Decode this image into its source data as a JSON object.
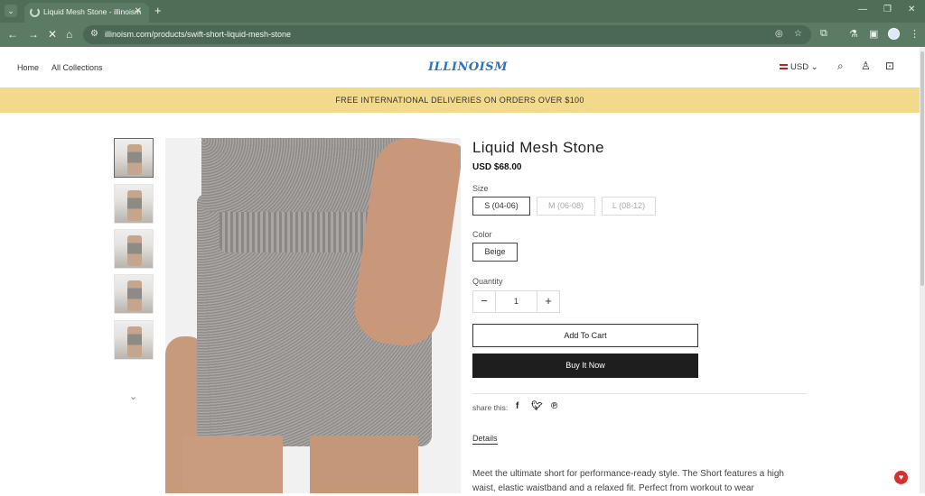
{
  "browser": {
    "tab_title": "Liquid Mesh Stone - illinoism",
    "url": "illinoism.com/products/swift-short-liquid-mesh-stone"
  },
  "header": {
    "nav": [
      "Home",
      "All Collections"
    ],
    "logo": "ILLINOISM",
    "currency": "USD"
  },
  "announcement": "FREE INTERNATIONAL DELIVERIES ON ORDERS OVER $100",
  "product": {
    "title": "Liquid Mesh Stone",
    "price": "USD $68.00",
    "size_label": "Size",
    "sizes": [
      "S (04-06)",
      "M (06-08)",
      "L (08-12)"
    ],
    "selected_size": "S (04-06)",
    "color_label": "Color",
    "colors": [
      "Beige"
    ],
    "quantity_label": "Quantity",
    "quantity": "1",
    "add_to_cart": "Add To Cart",
    "buy_now": "Buy It Now",
    "share_label": "share this:",
    "details_tab": "Details",
    "description": "Meet the ultimate short for performance-ready style. The  Short features a high waist, elastic waistband and a relaxed fit. Perfect from workout to wear"
  },
  "icons": {
    "share": [
      "facebook-icon",
      "twitter-icon",
      "pinterest-icon"
    ],
    "header": [
      "search-icon",
      "account-icon",
      "cart-icon"
    ]
  }
}
